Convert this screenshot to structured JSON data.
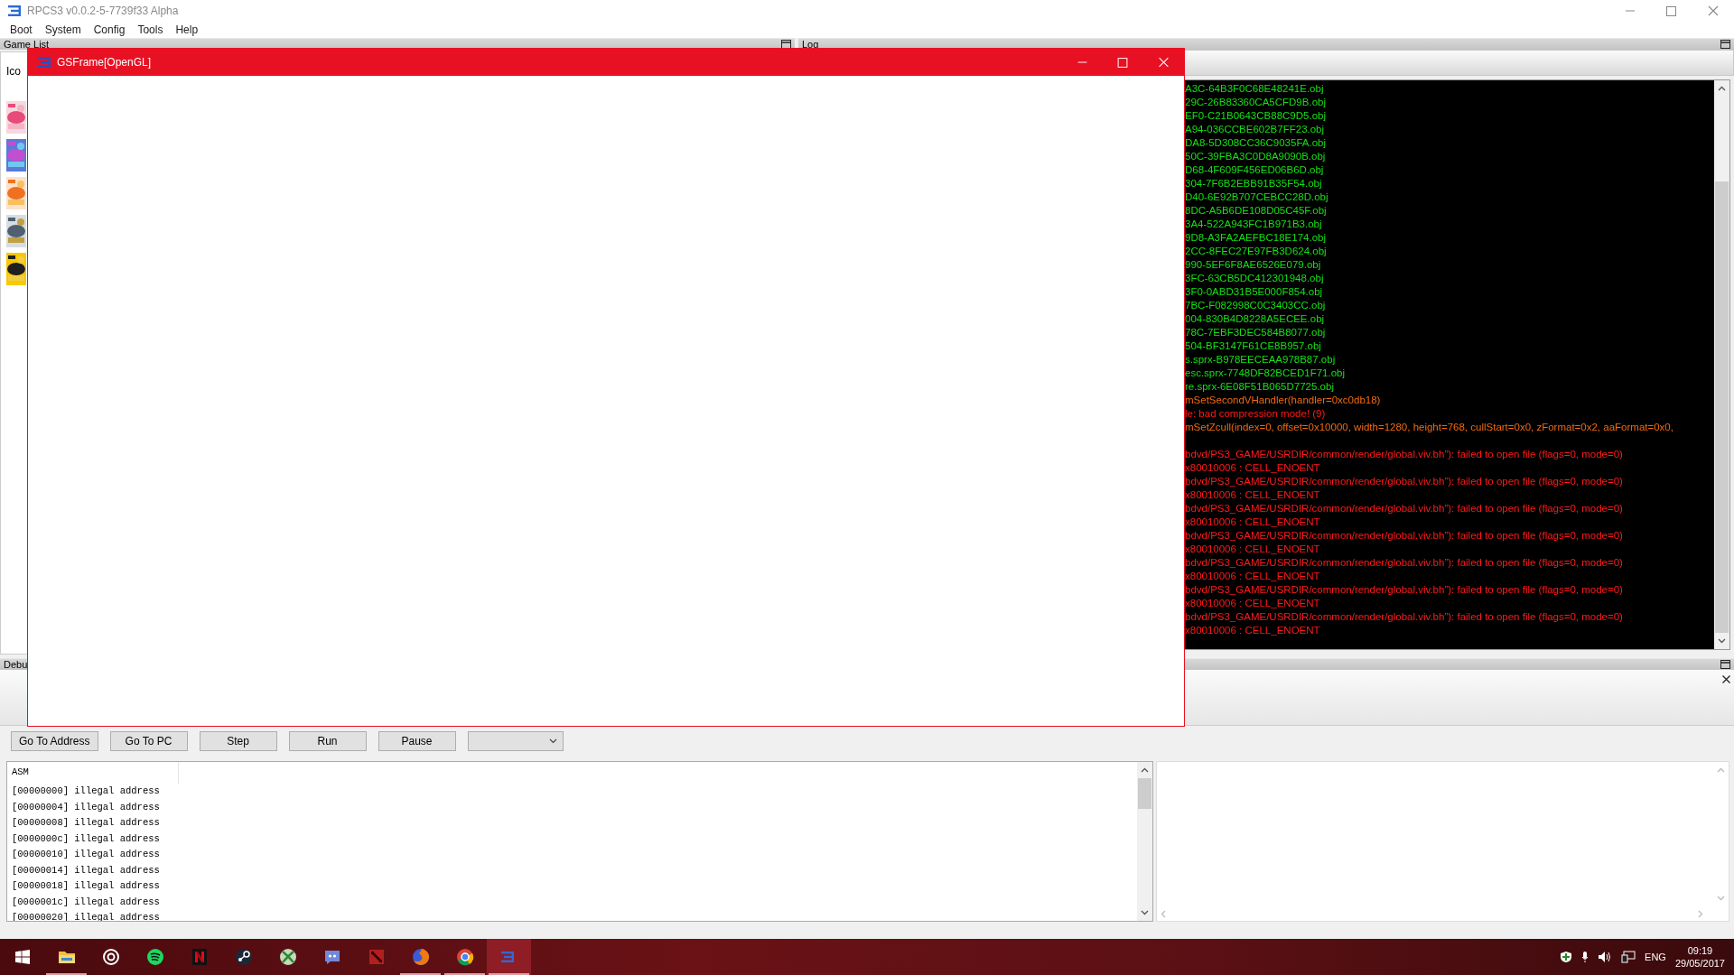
{
  "app": {
    "title": "RPCS3 v0.0.2-5-7739f33 Alpha",
    "menu": [
      "Boot",
      "System",
      "Config",
      "Tools",
      "Help"
    ]
  },
  "game_list": {
    "title": "Game List",
    "column_1": "Ico"
  },
  "log": {
    "title": "Log",
    "lines": [
      {
        "text": "A3C-64B3F0C68E48241E.obj",
        "color": "#16e016"
      },
      {
        "text": "29C-26B83360CA5CFD9B.obj",
        "color": "#16e016"
      },
      {
        "text": "EF0-C21B0643CB88C9D5.obj",
        "color": "#16e016"
      },
      {
        "text": "A94-036CCBE602B7FF23.obj",
        "color": "#16e016"
      },
      {
        "text": "DA8-5D308CC36C9035FA.obj",
        "color": "#16e016"
      },
      {
        "text": "50C-39FBA3C0D8A9090B.obj",
        "color": "#16e016"
      },
      {
        "text": "D68-4F609F456ED06B6D.obj",
        "color": "#16e016"
      },
      {
        "text": "304-7F6B2EBB91B35F54.obj",
        "color": "#16e016"
      },
      {
        "text": "D40-6E92B707CEBCC28D.obj",
        "color": "#16e016"
      },
      {
        "text": "8DC-A5B6DE108D05C45F.obj",
        "color": "#16e016"
      },
      {
        "text": "3A4-522A943FC1B971B3.obj",
        "color": "#16e016"
      },
      {
        "text": "9D8-A3FA2AEFBC18E174.obj",
        "color": "#16e016"
      },
      {
        "text": "2CC-8FEC27E97FB3D624.obj",
        "color": "#16e016"
      },
      {
        "text": "990-5EF6F8AE6526E079.obj",
        "color": "#16e016"
      },
      {
        "text": "3FC-63CB5DC412301948.obj",
        "color": "#16e016"
      },
      {
        "text": "3F0-0ABD31B5E000F854.obj",
        "color": "#16e016"
      },
      {
        "text": "7BC-F082998C0C3403CC.obj",
        "color": "#16e016"
      },
      {
        "text": "004-830B4D8228A5ECEE.obj",
        "color": "#16e016"
      },
      {
        "text": "78C-7EBF3DEC584B8077.obj",
        "color": "#16e016"
      },
      {
        "text": "504-BF3147F61CE8B957.obj",
        "color": "#16e016"
      },
      {
        "text": "s.sprx-B978EECEAA978B87.obj",
        "color": "#16e016"
      },
      {
        "text": "esc.sprx-7748DF82BCED1F71.obj",
        "color": "#16e016"
      },
      {
        "text": "re.sprx-6E08F51B065D7725.obj",
        "color": "#16e016"
      },
      {
        "text": "mSetSecondVHandler(handler=0xc0db18)",
        "color": "#f06a10"
      },
      {
        "text": "le: bad compression mode! (9)",
        "color": "#ff1a1a"
      },
      {
        "text": "mSetZcull(index=0, offset=0x10000, width=1280, height=768, cullStart=0x0, zFormat=0x2, aaFormat=0x0,",
        "color": "#f06a10"
      },
      {
        "text": "bdvd/PS3_GAME/USRDIR/common/render/global.viv.bh”): failed to open file (flags=0, mode=0)",
        "color": "#ff1a1a",
        "gap_before": true
      },
      {
        "text": "x80010006 : CELL_ENOENT",
        "color": "#ff1a1a"
      },
      {
        "text": "bdvd/PS3_GAME/USRDIR/common/render/global.viv.bh”): failed to open file (flags=0, mode=0)",
        "color": "#ff1a1a"
      },
      {
        "text": "x80010006 : CELL_ENOENT",
        "color": "#ff1a1a"
      },
      {
        "text": "bdvd/PS3_GAME/USRDIR/common/render/global.viv.bh”): failed to open file (flags=0, mode=0)",
        "color": "#ff1a1a"
      },
      {
        "text": "x80010006 : CELL_ENOENT",
        "color": "#ff1a1a"
      },
      {
        "text": "bdvd/PS3_GAME/USRDIR/common/render/global.viv.bh”): failed to open file (flags=0, mode=0)",
        "color": "#ff1a1a"
      },
      {
        "text": "x80010006 : CELL_ENOENT",
        "color": "#ff1a1a"
      },
      {
        "text": "bdvd/PS3_GAME/USRDIR/common/render/global.viv.bh”): failed to open file (flags=0, mode=0)",
        "color": "#ff1a1a"
      },
      {
        "text": "x80010006 : CELL_ENOENT",
        "color": "#ff1a1a"
      },
      {
        "text": "bdvd/PS3_GAME/USRDIR/common/render/global.viv.bh”): failed to open file (flags=0, mode=0)",
        "color": "#ff1a1a"
      },
      {
        "text": "x80010006 : CELL_ENOENT",
        "color": "#ff1a1a"
      },
      {
        "text": "bdvd/PS3_GAME/USRDIR/common/render/global.viv.bh”): failed to open file (flags=0, mode=0)",
        "color": "#ff1a1a"
      },
      {
        "text": "x80010006 : CELL_ENOENT",
        "color": "#ff1a1a"
      }
    ]
  },
  "debugger": {
    "title": "Debu",
    "buttons": [
      "Go To Address",
      "Go To PC",
      "Step",
      "Run",
      "Pause"
    ],
    "asm": {
      "column": "ASM",
      "rows": [
        "[00000000] illegal address",
        "[00000004] illegal address",
        "[00000008] illegal address",
        "[0000000c] illegal address",
        "[00000010] illegal address",
        "[00000014] illegal address",
        "[00000018] illegal address",
        "[0000001c] illegal address",
        "[00000020] illegal address"
      ]
    }
  },
  "gsframe": {
    "title": "GSFrame[OpenGL]"
  },
  "taskbar": {
    "apps": [
      {
        "kind": "folder",
        "selected": false,
        "running": true
      },
      {
        "kind": "ring",
        "selected": false,
        "running": false
      },
      {
        "kind": "waves",
        "selected": false,
        "running": false
      },
      {
        "kind": "tile",
        "selected": false,
        "running": false
      },
      {
        "kind": "piston",
        "selected": false,
        "running": false
      },
      {
        "kind": "sphere",
        "selected": false,
        "running": false
      },
      {
        "kind": "chat",
        "selected": false,
        "running": false
      },
      {
        "kind": "emblem",
        "selected": false,
        "running": false
      },
      {
        "kind": "globe",
        "selected": false,
        "running": true
      },
      {
        "kind": "wheel",
        "selected": false,
        "running": true
      },
      {
        "kind": "bars",
        "selected": true,
        "running": true
      }
    ],
    "language": "ENG",
    "time": "09:19",
    "date": "29/05/2017"
  }
}
